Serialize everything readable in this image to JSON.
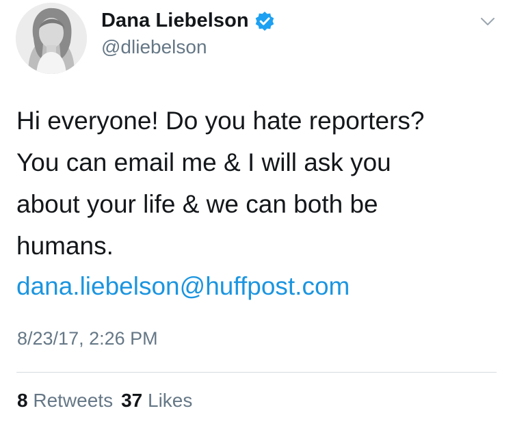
{
  "author": {
    "display_name": "Dana Liebelson",
    "handle": "@dliebelson",
    "verified_icon": "verified-badge-icon",
    "verified_color": "#1da1f2"
  },
  "tweet": {
    "text": "Hi everyone! Do you hate reporters?\nYou can email me & I will ask you\nabout your life & we can both be\nhumans.",
    "link": "dana.liebelson@huffpost.com",
    "timestamp": "8/23/17, 2:26 PM"
  },
  "stats": {
    "retweets_count": "8",
    "retweets_label": "Retweets",
    "likes_count": "37",
    "likes_label": "Likes"
  },
  "colors": {
    "link": "#1b95e0",
    "secondary_text": "#657786",
    "primary_text": "#14171a"
  }
}
